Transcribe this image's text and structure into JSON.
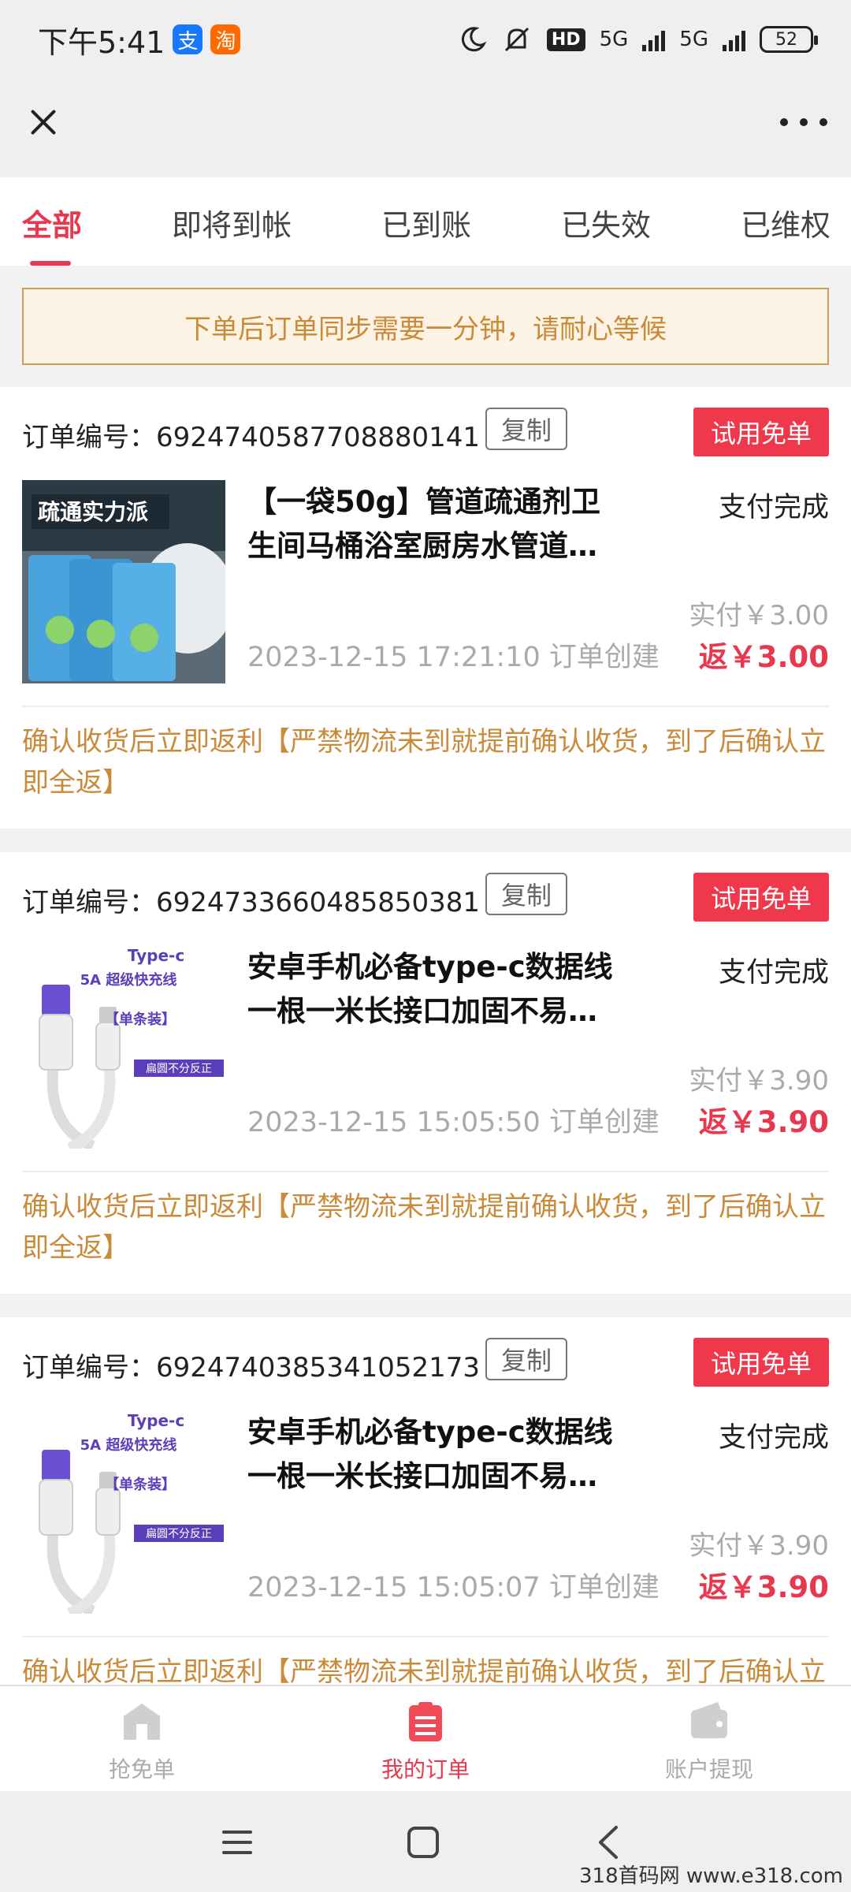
{
  "status_bar": {
    "time": "下午5:41",
    "apps": [
      {
        "icon": "alipay-icon",
        "glyph": "支",
        "color": "#1677ff"
      },
      {
        "icon": "taobao-icon",
        "glyph": "淘",
        "color": "#ff6a00"
      }
    ],
    "hd_label": "HD",
    "network_1": "5G",
    "network_2": "5G",
    "battery": "52"
  },
  "tabs": [
    {
      "label": "全部",
      "active": true
    },
    {
      "label": "即将到帐",
      "active": false
    },
    {
      "label": "已到账",
      "active": false
    },
    {
      "label": "已失效",
      "active": false
    },
    {
      "label": "已维权",
      "active": false
    }
  ],
  "notice": "下单后订单同步需要一分钟，请耐心等候",
  "orders": [
    {
      "order_label": "订单编号：6924740587708880141",
      "copy_label": "复制",
      "badge": "试用免单",
      "title_line1": "【一袋50g】管道疏通剂卫",
      "title_line2": "生间马桶浴室厨房水管道…",
      "status": "支付完成",
      "actual": "实付￥3.00",
      "created": "2023-12-15 17:21:10 订单创建",
      "rebate": "返￥3.00",
      "note": "确认收货后立即返利【严禁物流未到就提前确认收货，到了后确认立即全返】",
      "thumb_type": "cleaner",
      "thumb_caption": "疏通实力派"
    },
    {
      "order_label": "订单编号：6924733660485850381",
      "copy_label": "复制",
      "badge": "试用免单",
      "title_line1": "安卓手机必备type-c数据线",
      "title_line2": "一根一米长接口加固不易…",
      "status": "支付完成",
      "actual": "实付￥3.90",
      "created": "2023-12-15 15:05:50 订单创建",
      "rebate": "返￥3.90",
      "note": "确认收货后立即返利【严禁物流未到就提前确认收货，到了后确认立即全返】",
      "thumb_type": "cable",
      "thumb_texts": [
        "Type-c",
        "5A 超级快充线",
        "【单条装】",
        "扁圆不分反正"
      ]
    },
    {
      "order_label": "订单编号：6924740385341052173",
      "copy_label": "复制",
      "badge": "试用免单",
      "title_line1": "安卓手机必备type-c数据线",
      "title_line2": "一根一米长接口加固不易…",
      "status": "支付完成",
      "actual": "实付￥3.90",
      "created": "2023-12-15 15:05:07 订单创建",
      "rebate": "返￥3.90",
      "note": "确认收货后立即返利【严禁物流未到就提前确认收货，到了后确认立即全返】",
      "thumb_type": "cable",
      "thumb_texts": [
        "Type-c",
        "5A 超级快充线",
        "【单条装】",
        "扁圆不分反正"
      ]
    }
  ],
  "bottom_nav": [
    {
      "label": "抢免单",
      "icon": "store-icon",
      "active": false
    },
    {
      "label": "我的订单",
      "icon": "order-list-icon",
      "active": true
    },
    {
      "label": "账户提现",
      "icon": "wallet-icon",
      "active": false
    }
  ],
  "watermark": "318首码网  www.e318.com",
  "colors": {
    "accent": "#e8384f",
    "notice_text": "#c98a3a",
    "badge": "#f0384c"
  }
}
